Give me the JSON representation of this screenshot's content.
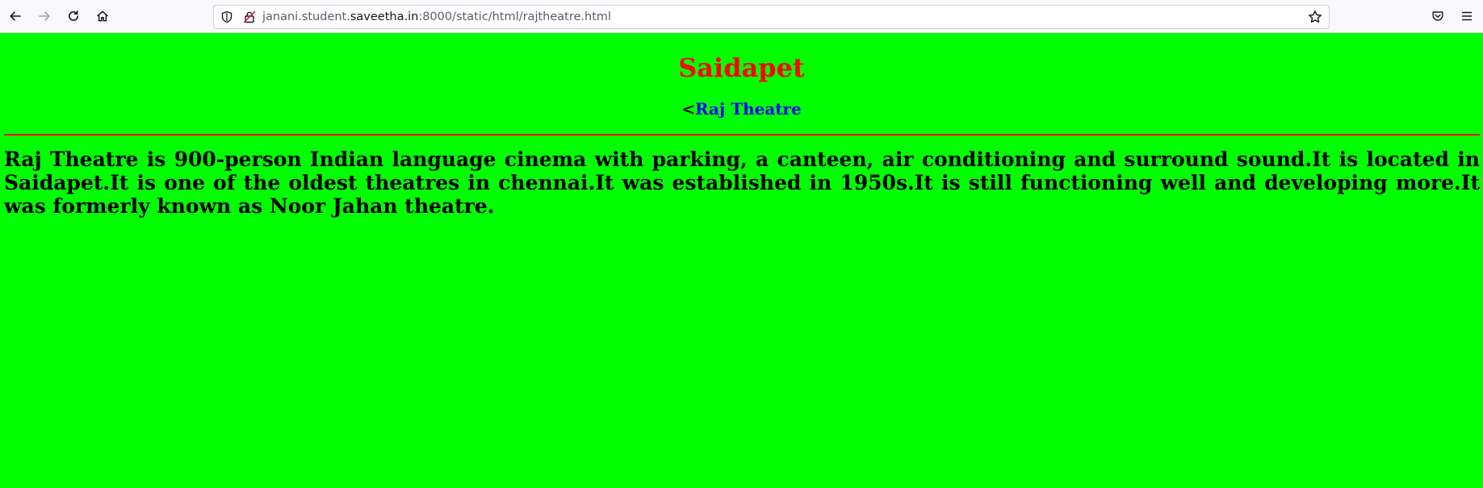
{
  "browser": {
    "url_prefix": "janani.student.",
    "url_host": "saveetha.in",
    "url_suffix": ":8000/static/html/rajtheatre.html",
    "icons": {
      "back": "back-arrow-icon",
      "forward": "forward-arrow-icon",
      "reload": "reload-icon",
      "home": "home-icon",
      "shield": "shield-icon",
      "lock": "insecure-lock-icon",
      "bookmark": "star-icon",
      "pocket": "pocket-icon",
      "menu": "hamburger-menu-icon"
    }
  },
  "page": {
    "background": "#00ff00",
    "heading": "Saidapet",
    "heading_color": "#ff0000",
    "nav_prefix": "<",
    "nav_link": "Raj Theatre",
    "rule_color": "#ff0000",
    "paragraph": "Raj Theatre is 900-person Indian language cinema with parking, a canteen, air conditioning and surround sound.It is located in Saidapet.It is one of the oldest theatres in chennai.It was established in 1950s.It is still functioning well and developing more.It was formerly known as Noor Jahan theatre."
  }
}
